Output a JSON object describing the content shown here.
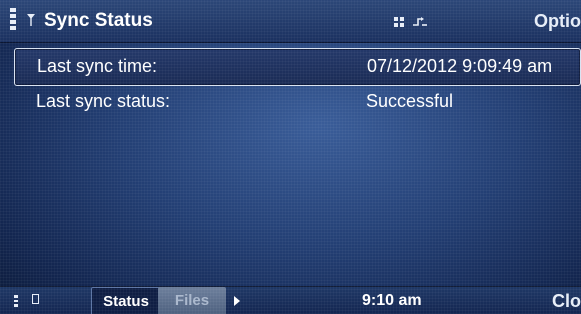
{
  "title_bar": {
    "title": "Sync Status",
    "options_label": "Options",
    "icons": [
      "signal-strength-icon",
      "antenna-icon",
      "grid-icon",
      "data-connection-icon"
    ]
  },
  "rows": [
    {
      "label": "Last sync time:",
      "value": "07/12/2012 9:09:49 am",
      "selected": true
    },
    {
      "label": "Last sync status:",
      "value": "Successful",
      "selected": false
    }
  ],
  "bottom_bar": {
    "tabs": [
      {
        "label": "Status",
        "active": true
      },
      {
        "label": "Files",
        "active": false
      }
    ],
    "clock": "9:10 am",
    "close_label": "Close",
    "icons": [
      "battery-icon",
      "small-indicator-icon",
      "tab-more-arrow-icon"
    ]
  },
  "colors": {
    "background": "#233f74",
    "title_bar": "#2c4778",
    "active_tab": "#0f1e44",
    "inactive_tab": "#6d7f9c",
    "text": "#ffffff"
  }
}
